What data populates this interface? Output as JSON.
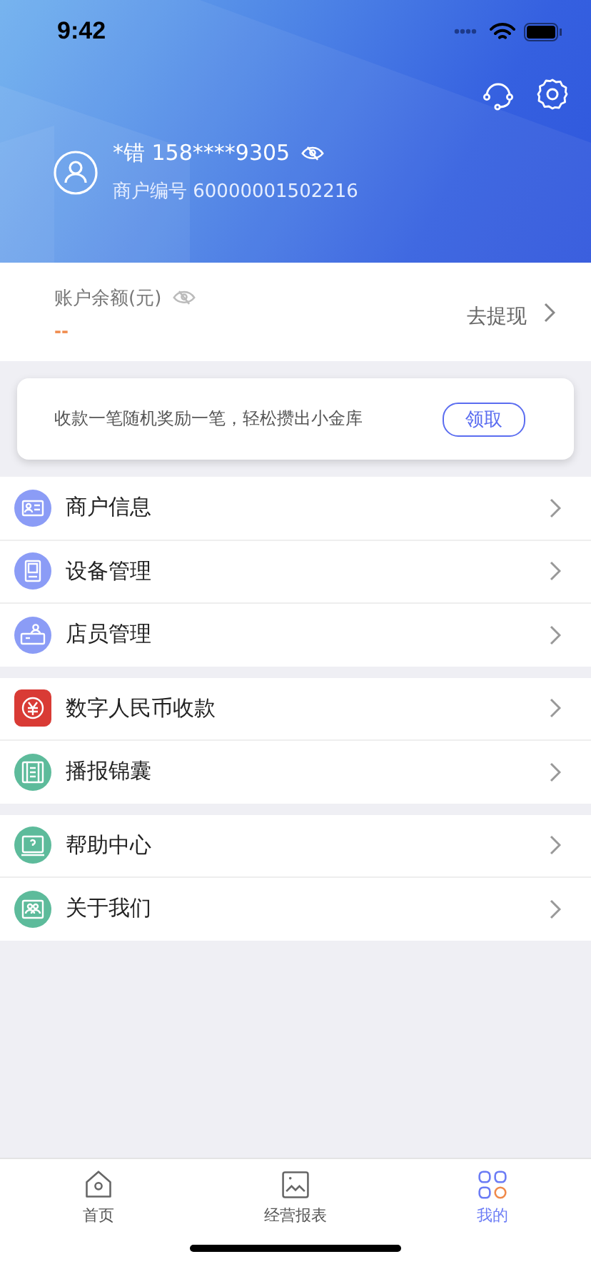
{
  "status_bar": {
    "time": "9:42"
  },
  "profile": {
    "name": "*错 158****9305",
    "merchant_no": "商户编号 60000001502216"
  },
  "balance": {
    "label": "账户余额(元)",
    "amount": "--",
    "withdraw": "去提现"
  },
  "banner": {
    "text": "收款一笔随机奖励一笔，轻松攒出小金库",
    "button": "领取"
  },
  "menu_groups": [
    [
      {
        "label": "商户信息",
        "kind": "card",
        "color": "#8b9cf6"
      },
      {
        "label": "设备管理",
        "kind": "device",
        "color": "#8b9cf6"
      },
      {
        "label": "店员管理",
        "kind": "staff",
        "color": "#8b9cf6"
      }
    ],
    [
      {
        "label": "数字人民币收款",
        "kind": "yuan",
        "color": "#d93b35"
      },
      {
        "label": "播报锦囊",
        "kind": "list",
        "color": "#5dbb9b"
      }
    ],
    [
      {
        "label": "帮助中心",
        "kind": "help",
        "color": "#5dbb9b"
      },
      {
        "label": "关于我们",
        "kind": "about",
        "color": "#5dbb9b"
      }
    ]
  ],
  "tabs": [
    {
      "label": "首页",
      "kind": "home",
      "selected": false
    },
    {
      "label": "经营报表",
      "kind": "report",
      "selected": false
    },
    {
      "label": "我的",
      "kind": "mine",
      "selected": true
    }
  ]
}
